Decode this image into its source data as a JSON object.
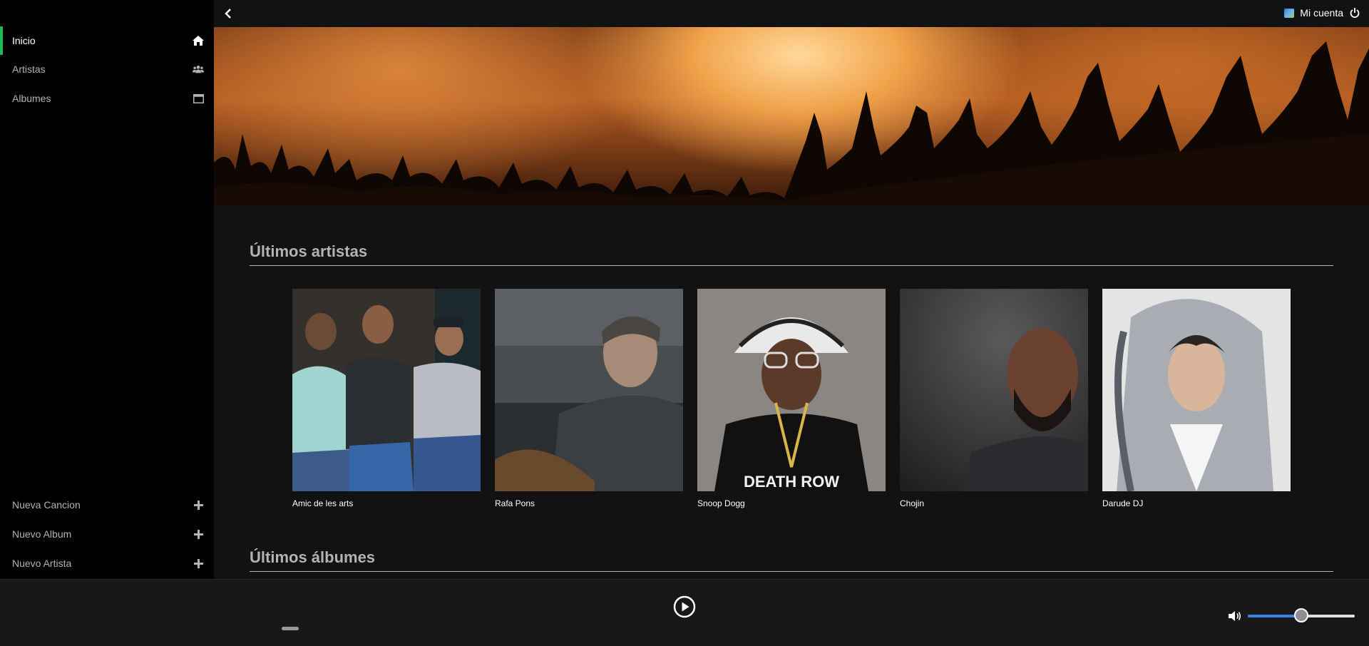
{
  "sidebar": {
    "top_items": [
      {
        "label": "Inicio",
        "icon": "home-icon",
        "active": true
      },
      {
        "label": "Artistas",
        "icon": "users-icon",
        "active": false
      },
      {
        "label": "Albumes",
        "icon": "window-icon",
        "active": false
      }
    ],
    "bottom_items": [
      {
        "label": "Nueva Cancion",
        "icon": "plus-icon"
      },
      {
        "label": "Nuevo Album",
        "icon": "plus-icon"
      },
      {
        "label": "Nuevo Artista",
        "icon": "plus-icon"
      }
    ]
  },
  "topbar": {
    "back_icon": "chevron-left-icon",
    "account_label": "Mi cuenta",
    "power_icon": "power-icon"
  },
  "main": {
    "latest_artists_title": "Últimos artistas",
    "latest_albums_title": "Últimos álbumes",
    "artists": [
      {
        "name": "Amic de les arts"
      },
      {
        "name": "Rafa Pons"
      },
      {
        "name": "Snoop Dogg"
      },
      {
        "name": "Chojin"
      },
      {
        "name": "Darude DJ"
      }
    ]
  },
  "player": {
    "play_icon": "play-circle-icon",
    "volume_icon": "volume-icon",
    "volume_level": 0.5
  },
  "colors": {
    "accent": "#1db954",
    "sidebar_bg": "#000000",
    "main_bg": "#121212",
    "volume_fill": "#3b82e6"
  }
}
